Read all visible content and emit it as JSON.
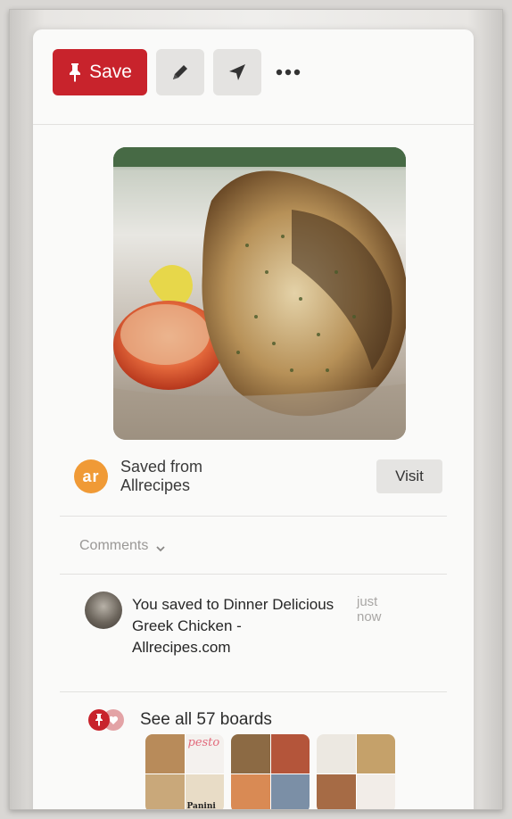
{
  "toolbar": {
    "save_label": "Save",
    "edit_icon": "pencil-icon",
    "send_icon": "send-icon",
    "more_icon": "more-icon"
  },
  "pin": {
    "image_icon": "recipe-photo",
    "source_logo_text": "ar",
    "source_line1": "Saved from",
    "source_line2": "Allrecipes",
    "visit_label": "Visit"
  },
  "comments": {
    "label": "Comments"
  },
  "activity": {
    "text": "You saved to Dinner Delicious\nGreek Chicken - Allrecipes.com",
    "time": "just now"
  },
  "boards": {
    "label": "See all 57 boards",
    "thumb_text_1": "pesto",
    "thumb_text_2": "Panini"
  },
  "colors": {
    "brand_red": "#c8232c",
    "source_orange": "#f09a36"
  }
}
